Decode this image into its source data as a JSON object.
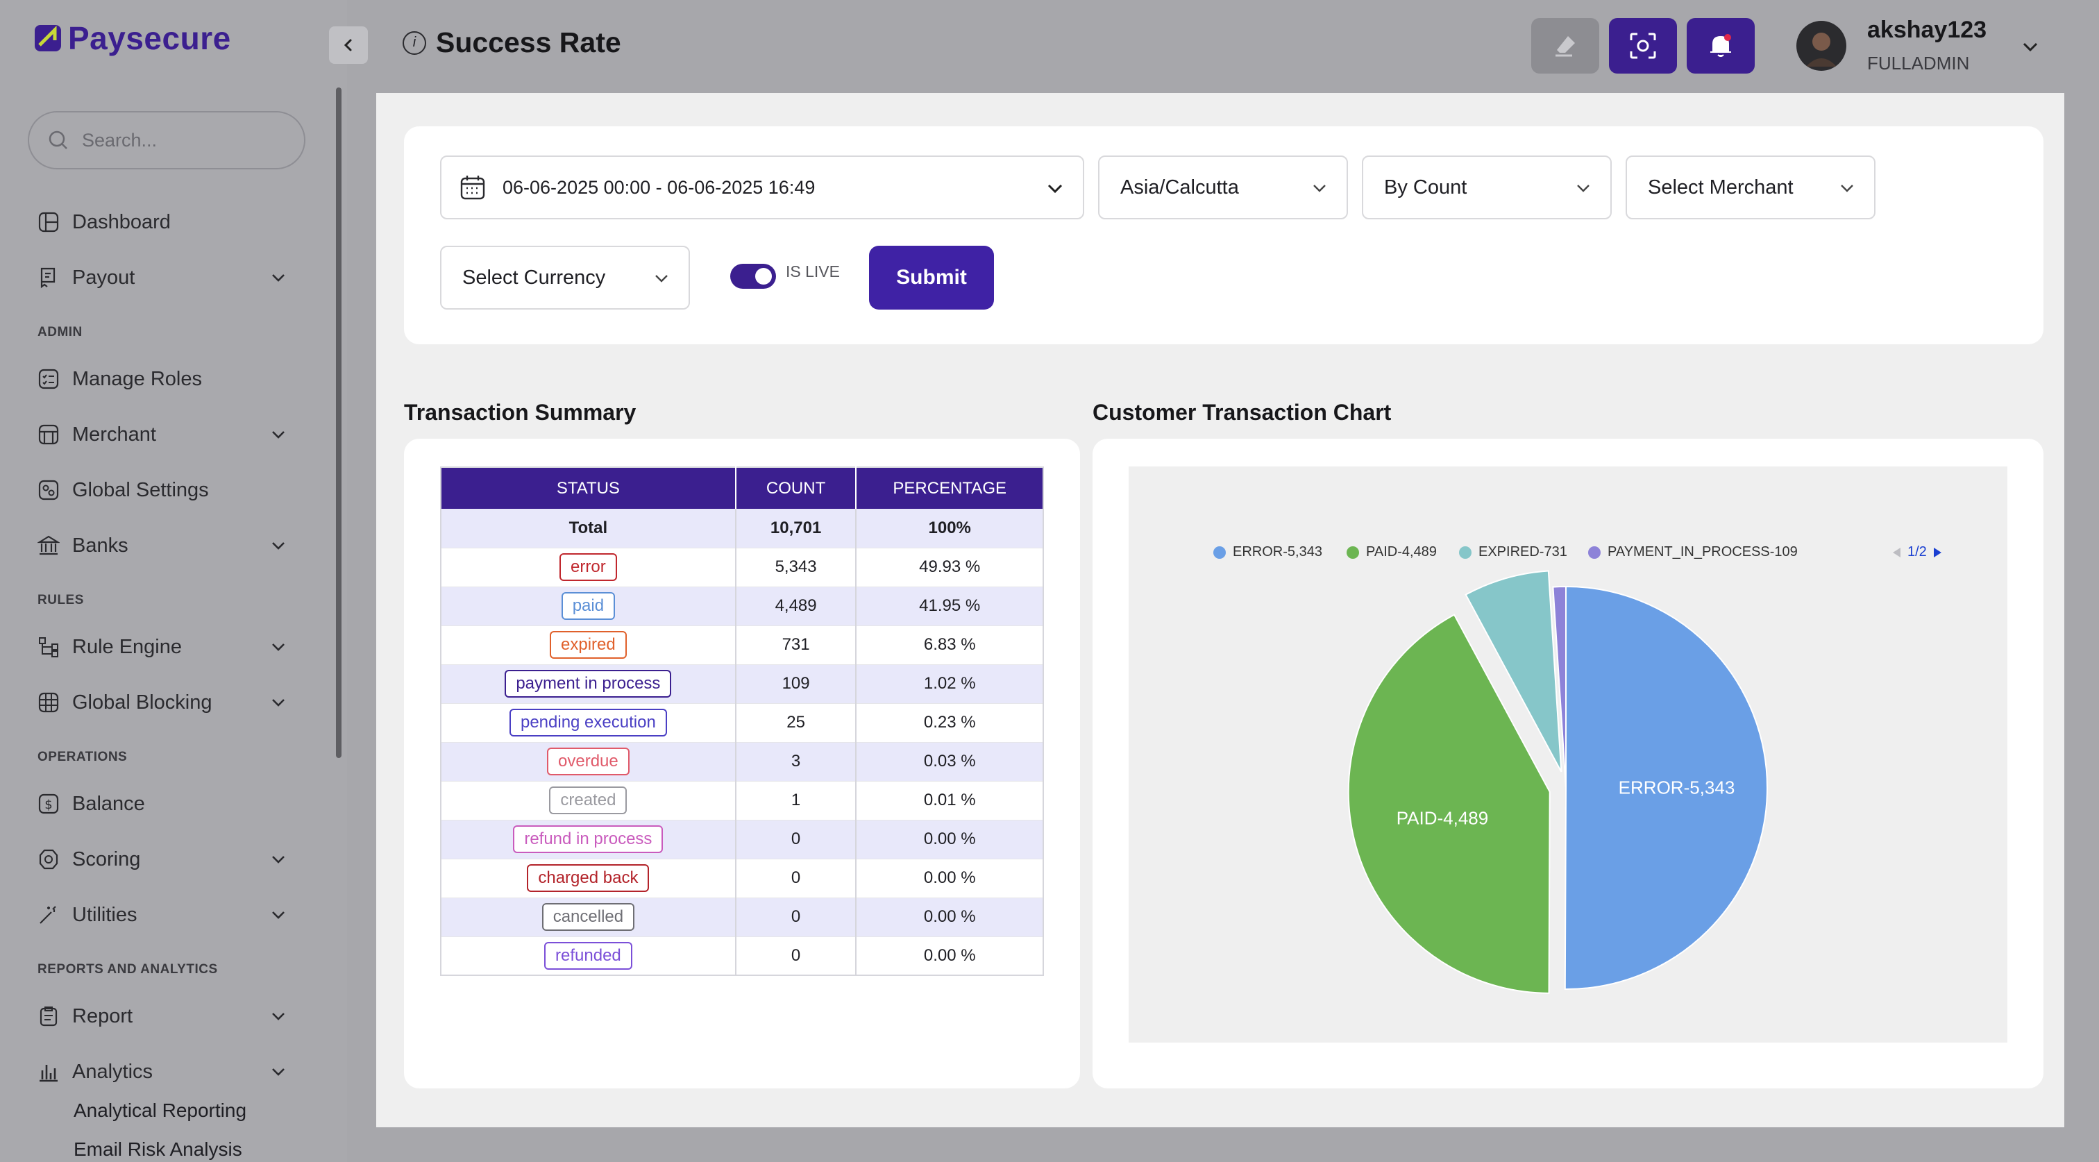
{
  "brand": {
    "name": "Paysecure"
  },
  "sidebar": {
    "search_placeholder": "Search...",
    "items": {
      "dashboard": "Dashboard",
      "payout": "Payout",
      "admin_section": "ADMIN",
      "manage_roles": "Manage Roles",
      "merchant": "Merchant",
      "global_settings": "Global Settings",
      "banks": "Banks",
      "rules_section": "RULES",
      "rule_engine": "Rule Engine",
      "global_blocking": "Global Blocking",
      "operations_section": "OPERATIONS",
      "balance": "Balance",
      "scoring": "Scoring",
      "utilities": "Utilities",
      "reports_section": "REPORTS AND ANALYTICS",
      "report": "Report",
      "analytics": "Analytics",
      "analytical_reporting": "Analytical Reporting",
      "email_risk_analysis": "Email Risk Analysis"
    }
  },
  "header": {
    "title": "Success Rate",
    "user_name": "akshay123",
    "user_role": "FULLADMIN"
  },
  "filters": {
    "date_range": "06-06-2025 00:00 - 06-06-2025 16:49",
    "timezone": "Asia/Calcutta",
    "metric": "By Count",
    "merchant": "Select Merchant",
    "currency": "Select Currency",
    "is_live_label": "IS LIVE",
    "is_live": true,
    "submit_label": "Submit"
  },
  "summary": {
    "title": "Transaction Summary",
    "headers": [
      "STATUS",
      "COUNT",
      "PERCENTAGE"
    ],
    "total": {
      "status": "Total",
      "count": "10,701",
      "percentage": "100%"
    },
    "rows": [
      {
        "status": "error",
        "count": "5,343",
        "percentage": "49.93 %",
        "color": "#c0272d"
      },
      {
        "status": "paid",
        "count": "4,489",
        "percentage": "41.95 %",
        "color": "#5b8fd6"
      },
      {
        "status": "expired",
        "count": "731",
        "percentage": "6.83 %",
        "color": "#e0602b"
      },
      {
        "status": "payment in process",
        "count": "109",
        "percentage": "1.02 %",
        "color": "#3b1f8f"
      },
      {
        "status": "pending execution",
        "count": "25",
        "percentage": "0.23 %",
        "color": "#4a3fc4"
      },
      {
        "status": "overdue",
        "count": "3",
        "percentage": "0.03 %",
        "color": "#e05a6a"
      },
      {
        "status": "created",
        "count": "1",
        "percentage": "0.01 %",
        "color": "#9a9aa0"
      },
      {
        "status": "refund in process",
        "count": "0",
        "percentage": "0.00 %",
        "color": "#c95bbd"
      },
      {
        "status": "charged back",
        "count": "0",
        "percentage": "0.00 %",
        "color": "#b3232a"
      },
      {
        "status": "cancelled",
        "count": "0",
        "percentage": "0.00 %",
        "color": "#6e6e74"
      },
      {
        "status": "refunded",
        "count": "0",
        "percentage": "0.00 %",
        "color": "#7b4fd8"
      }
    ]
  },
  "chart": {
    "title": "Customer Transaction Chart",
    "pager": "1/2"
  },
  "chart_data": {
    "type": "pie",
    "legend_position": "top",
    "series": [
      {
        "name": "ERROR-5,343",
        "value": 5343,
        "color": "#6a9fe6"
      },
      {
        "name": "PAID-4,489",
        "value": 4489,
        "color": "#6cb552"
      },
      {
        "name": "EXPIRED-731",
        "value": 731,
        "color": "#86c6c9"
      },
      {
        "name": "PAYMENT_IN_PROCESS-109",
        "value": 109,
        "color": "#8d82d8"
      }
    ],
    "slice_labels": [
      "ERROR-5,343",
      "PAID-4,489"
    ]
  }
}
